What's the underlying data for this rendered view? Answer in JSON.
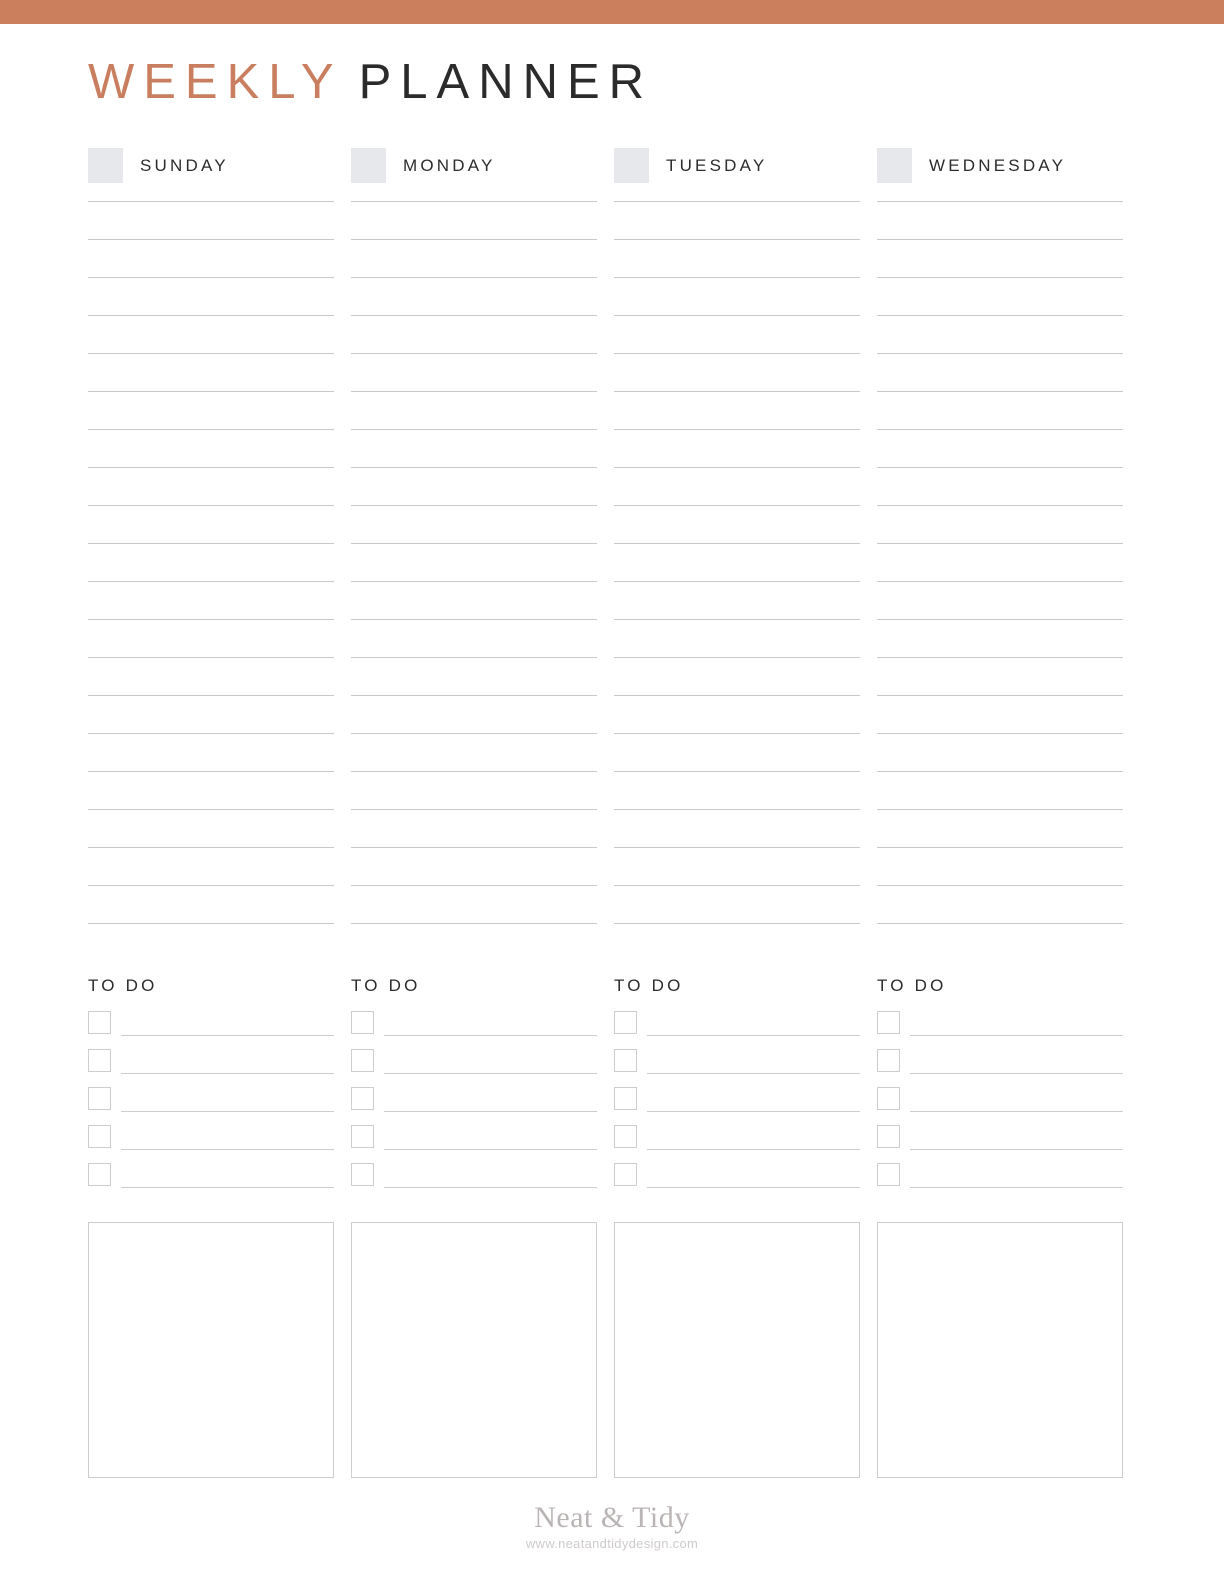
{
  "theme": {
    "accent_color": "#cc7f5d",
    "title_accent_color": "#c97f5f",
    "title_dark_color": "#2b2b2b",
    "swatch_color": "#e7e8ec",
    "rule_color": "#c9c9c9",
    "border_color": "#cdcdcd",
    "background_color": "#ffffff",
    "footer_color": "#b9b5b4"
  },
  "header": {
    "title_accent": "WEEKLY",
    "title_rest": "PLANNER"
  },
  "layout": {
    "rule_line_count": 20,
    "rule_line_spacing_px": 38,
    "todo_row_count": 5,
    "column_count": 4
  },
  "columns": [
    {
      "day": "SUNDAY",
      "todo_label": "TO DO",
      "todo_items": [
        "",
        "",
        "",
        "",
        ""
      ],
      "notes": ""
    },
    {
      "day": "MONDAY",
      "todo_label": "TO DO",
      "todo_items": [
        "",
        "",
        "",
        "",
        ""
      ],
      "notes": ""
    },
    {
      "day": "TUESDAY",
      "todo_label": "TO DO",
      "todo_items": [
        "",
        "",
        "",
        "",
        ""
      ],
      "notes": ""
    },
    {
      "day": "WEDNESDAY",
      "todo_label": "TO DO",
      "todo_items": [
        "",
        "",
        "",
        "",
        ""
      ],
      "notes": ""
    }
  ],
  "footer": {
    "brand": "Neat & Tidy",
    "url": "www.neatandtidydesign.com"
  }
}
